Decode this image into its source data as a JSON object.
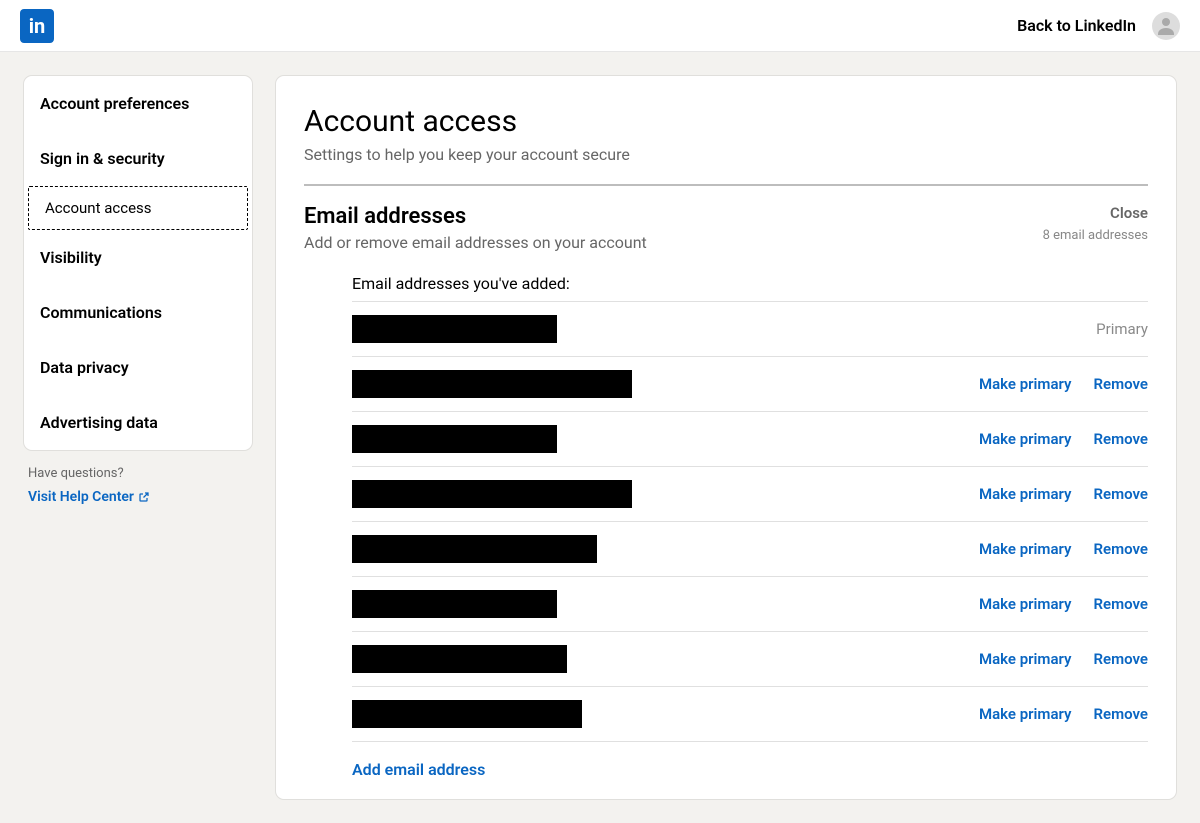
{
  "topbar": {
    "back_label": "Back to LinkedIn"
  },
  "sidebar": {
    "items": [
      {
        "label": "Account preferences"
      },
      {
        "label": "Sign in & security"
      },
      {
        "label": "Account access",
        "active": true
      },
      {
        "label": "Visibility"
      },
      {
        "label": "Communications"
      },
      {
        "label": "Data privacy"
      },
      {
        "label": "Advertising data"
      }
    ],
    "help_question": "Have questions?",
    "help_link": "Visit Help Center"
  },
  "main": {
    "title": "Account access",
    "subtitle": "Settings to help you keep your account secure",
    "section_title": "Email addresses",
    "section_subtitle": "Add or remove email addresses on your account",
    "close_label": "Close",
    "count_label": "8 email addresses",
    "list_header": "Email addresses you've added:",
    "primary_label": "Primary",
    "make_primary_label": "Make primary",
    "remove_label": "Remove",
    "add_label": "Add email address",
    "emails": [
      {
        "redact_width": 205,
        "primary": true
      },
      {
        "redact_width": 280,
        "primary": false
      },
      {
        "redact_width": 205,
        "primary": false
      },
      {
        "redact_width": 280,
        "primary": false
      },
      {
        "redact_width": 245,
        "primary": false
      },
      {
        "redact_width": 205,
        "primary": false
      },
      {
        "redact_width": 215,
        "primary": false
      },
      {
        "redact_width": 230,
        "primary": false
      }
    ]
  }
}
